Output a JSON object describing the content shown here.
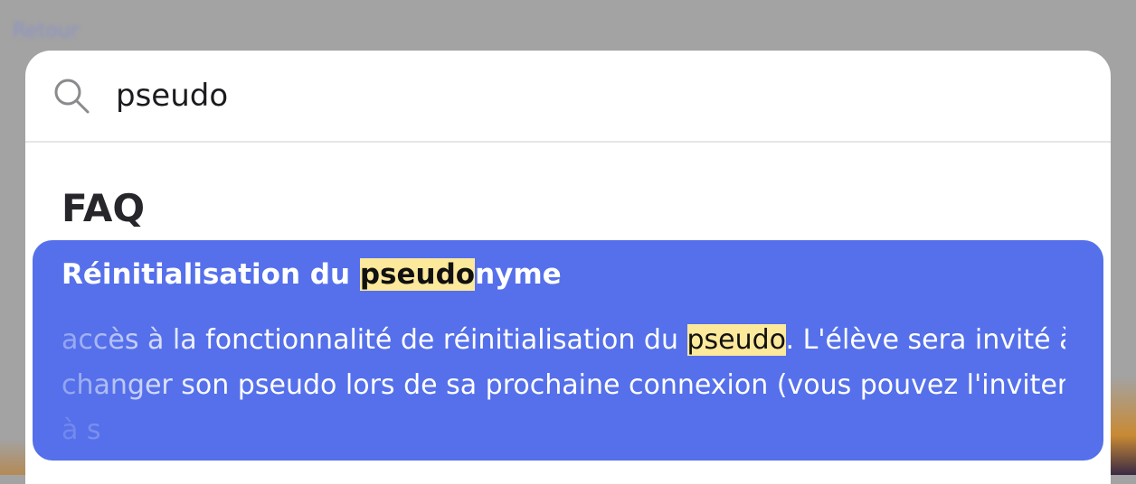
{
  "backdrop": {
    "link_text": "Retour"
  },
  "search": {
    "query": "pseudo",
    "icon": "search-icon"
  },
  "section": {
    "title": "FAQ"
  },
  "result": {
    "title_before": "Réinitialisation du ",
    "title_highlight": "pseudo",
    "title_after": "nyme",
    "desc_line1_before": "accès à la fonctionnalité de réinitialisation du ",
    "desc_line1_highlight": "pseudo",
    "desc_line1_after": ". L'élève sera invité à",
    "desc_line2": "changer son pseudo lors de sa prochaine connexion (vous pouvez l'inviter",
    "desc_line3": "à s"
  },
  "colors": {
    "card": "#5570ea",
    "highlight": "#fde99b",
    "overlay": "#a3a3a3"
  }
}
